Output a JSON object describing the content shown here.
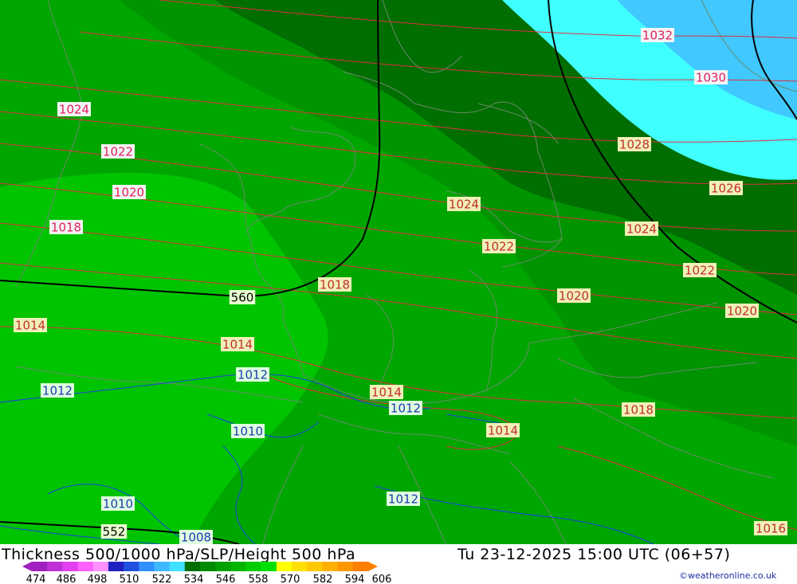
{
  "footer": {
    "title": "Thickness 500/1000 hPa/SLP/Height 500 hPa",
    "datetime": "Tu 23-12-2025 15:00 UTC (06+57)",
    "credit": "©weatheronline.co.uk"
  },
  "legend": {
    "ticks": [
      "474",
      "486",
      "498",
      "510",
      "522",
      "534",
      "546",
      "558",
      "570",
      "582",
      "594",
      "606"
    ],
    "colors": [
      "#a020c0",
      "#c030d8",
      "#e040f0",
      "#ff60ff",
      "#ff90ff",
      "#2020c0",
      "#2050e0",
      "#3090ff",
      "#40b8ff",
      "#40e0ff",
      "#006e00",
      "#008a00",
      "#00a000",
      "#00b400",
      "#00cc00",
      "#00e000",
      "#ffff00",
      "#ffe000",
      "#ffc800",
      "#ffb000",
      "#ff9800",
      "#ff8000"
    ]
  },
  "map": {
    "colors": {
      "thickness_534": "#006e00",
      "thickness_546": "#009400",
      "thickness_552": "#00a600",
      "thickness_558": "#00c400",
      "thickness_lt_522": "#40ffff",
      "thickness_lt_510": "#40c8ff",
      "isobar_line": "#e03040",
      "isobar_low": "#2040e0",
      "height_line": "#000000",
      "border_line": "#6a8a6a"
    },
    "height_labels": [
      "560",
      "552"
    ],
    "isobar_labels": [
      {
        "text": "1032",
        "kind": "high"
      },
      {
        "text": "1030",
        "kind": "high"
      },
      {
        "text": "1028",
        "kind": "mid"
      },
      {
        "text": "1026",
        "kind": "mid"
      },
      {
        "text": "1024",
        "kind": "high"
      },
      {
        "text": "1024",
        "kind": "mid"
      },
      {
        "text": "1024",
        "kind": "mid"
      },
      {
        "text": "1022",
        "kind": "high"
      },
      {
        "text": "1022",
        "kind": "mid"
      },
      {
        "text": "1022",
        "kind": "mid"
      },
      {
        "text": "1020",
        "kind": "high"
      },
      {
        "text": "1020",
        "kind": "mid"
      },
      {
        "text": "1020",
        "kind": "mid"
      },
      {
        "text": "1018",
        "kind": "high"
      },
      {
        "text": "1018",
        "kind": "mid"
      },
      {
        "text": "1018",
        "kind": "mid"
      },
      {
        "text": "1016",
        "kind": "mid"
      },
      {
        "text": "1014",
        "kind": "mid"
      },
      {
        "text": "1014",
        "kind": "mid"
      },
      {
        "text": "1014",
        "kind": "mid"
      },
      {
        "text": "1014",
        "kind": "mid"
      },
      {
        "text": "1012",
        "kind": "low"
      },
      {
        "text": "1012",
        "kind": "low"
      },
      {
        "text": "1012",
        "kind": "low"
      },
      {
        "text": "1012",
        "kind": "low"
      },
      {
        "text": "1010",
        "kind": "low"
      },
      {
        "text": "1010",
        "kind": "low"
      },
      {
        "text": "1008",
        "kind": "low"
      }
    ]
  }
}
